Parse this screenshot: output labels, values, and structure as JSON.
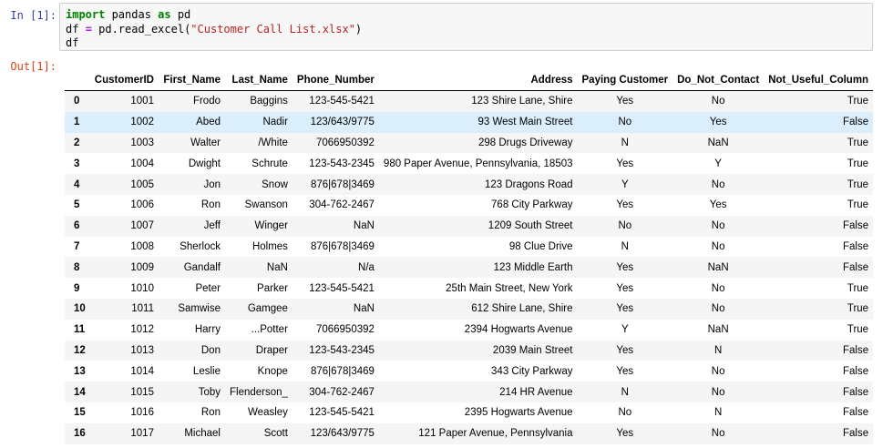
{
  "cell": {
    "in_prompt": "In [1]:",
    "out_prompt": "Out[1]:",
    "code": {
      "line1_kw1": "import",
      "line1_mod": " pandas ",
      "line1_kw2": "as",
      "line1_alias": " pd",
      "line2_pre": "df ",
      "line2_op": "=",
      "line2_mid": " pd.read_excel(",
      "line2_str": "\"Customer Call List.xlsx\"",
      "line2_post": ")",
      "line3": "df"
    }
  },
  "table": {
    "columns": [
      "",
      "CustomerID",
      "First_Name",
      "Last_Name",
      "Phone_Number",
      "Address",
      "Paying Customer",
      "Do_Not_Contact",
      "Not_Useful_Column"
    ],
    "selected_row": 1,
    "rows": [
      [
        "0",
        "1001",
        "Frodo",
        "Baggins",
        "123-545-5421",
        "123 Shire Lane, Shire",
        "Yes",
        "No",
        "True"
      ],
      [
        "1",
        "1002",
        "Abed",
        "Nadir",
        "123/643/9775",
        "93 West Main Street",
        "No",
        "Yes",
        "False"
      ],
      [
        "2",
        "1003",
        "Walter",
        "/White",
        "7066950392",
        "298 Drugs Driveway",
        "N",
        "NaN",
        "True"
      ],
      [
        "3",
        "1004",
        "Dwight",
        "Schrute",
        "123-543-2345",
        "980 Paper Avenue, Pennsylvania, 18503",
        "Yes",
        "Y",
        "True"
      ],
      [
        "4",
        "1005",
        "Jon",
        "Snow",
        "876|678|3469",
        "123 Dragons Road",
        "Y",
        "No",
        "True"
      ],
      [
        "5",
        "1006",
        "Ron",
        "Swanson",
        "304-762-2467",
        "768 City Parkway",
        "Yes",
        "Yes",
        "True"
      ],
      [
        "6",
        "1007",
        "Jeff",
        "Winger",
        "NaN",
        "1209 South Street",
        "No",
        "No",
        "False"
      ],
      [
        "7",
        "1008",
        "Sherlock",
        "Holmes",
        "876|678|3469",
        "98 Clue Drive",
        "N",
        "No",
        "False"
      ],
      [
        "8",
        "1009",
        "Gandalf",
        "NaN",
        "N/a",
        "123 Middle Earth",
        "Yes",
        "NaN",
        "False"
      ],
      [
        "9",
        "1010",
        "Peter",
        "Parker",
        "123-545-5421",
        "25th Main Street, New York",
        "Yes",
        "No",
        "True"
      ],
      [
        "10",
        "1011",
        "Samwise",
        "Gamgee",
        "NaN",
        "612 Shire Lane, Shire",
        "Yes",
        "No",
        "True"
      ],
      [
        "11",
        "1012",
        "Harry",
        "...Potter",
        "7066950392",
        "2394 Hogwarts Avenue",
        "Y",
        "NaN",
        "True"
      ],
      [
        "12",
        "1013",
        "Don",
        "Draper",
        "123-543-2345",
        "2039 Main Street",
        "Yes",
        "N",
        "False"
      ],
      [
        "13",
        "1014",
        "Leslie",
        "Knope",
        "876|678|3469",
        "343 City Parkway",
        "Yes",
        "No",
        "False"
      ],
      [
        "14",
        "1015",
        "Toby",
        "Flenderson_",
        "304-762-2467",
        "214 HR Avenue",
        "N",
        "No",
        "False"
      ],
      [
        "15",
        "1016",
        "Ron",
        "Weasley",
        "123-545-5421",
        "2395 Hogwarts Avenue",
        "No",
        "N",
        "False"
      ],
      [
        "16",
        "1017",
        "Michael",
        "Scott",
        "123/643/9775",
        "121 Paper Avenue, Pennsylvania",
        "Yes",
        "No",
        "False"
      ]
    ]
  }
}
